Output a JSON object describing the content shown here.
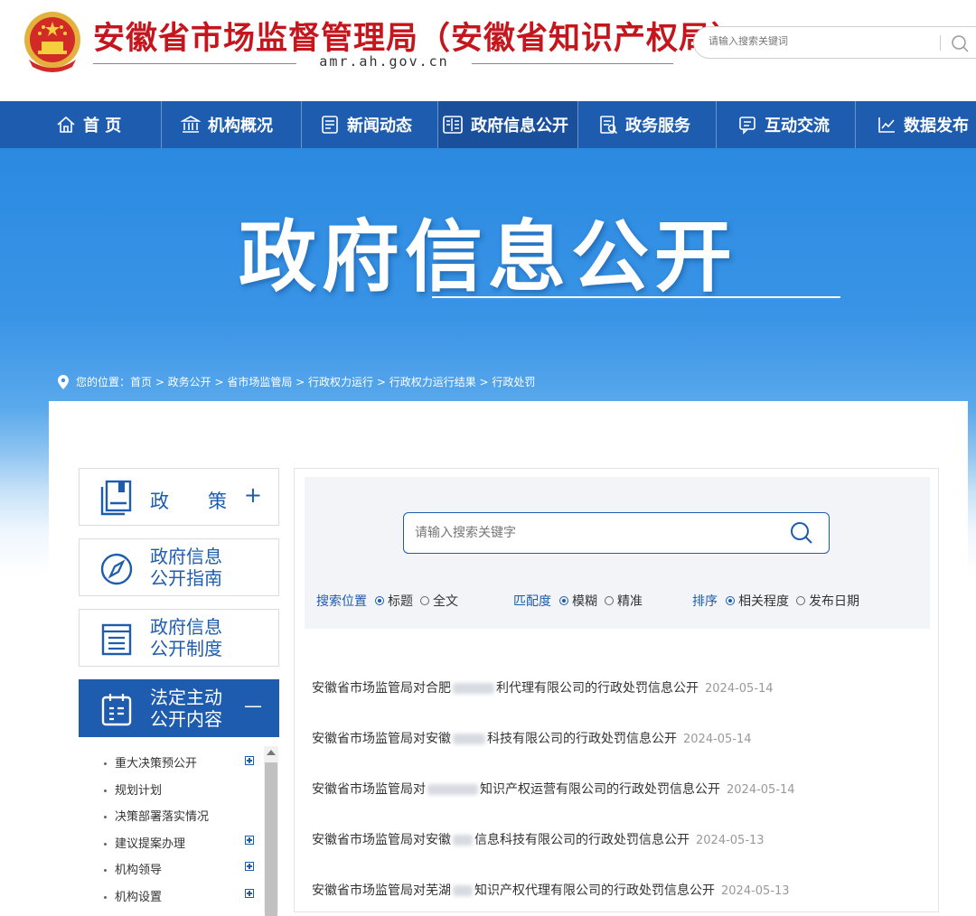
{
  "header": {
    "site_title": "安徽省市场监督管理局（安徽省知识产权局）",
    "domain": "amr.ah.gov.cn",
    "search_placeholder": "请输入搜索关键词",
    "emblem_icon": "national-emblem-icon"
  },
  "nav": {
    "items": [
      {
        "label": "首 页",
        "icon": "home-icon"
      },
      {
        "label": "机构概况",
        "icon": "institution-icon"
      },
      {
        "label": "新闻动态",
        "icon": "news-icon"
      },
      {
        "label": "政府信息公开",
        "icon": "info-disclosure-icon",
        "active": true
      },
      {
        "label": "政务服务",
        "icon": "service-icon"
      },
      {
        "label": "互动交流",
        "icon": "chat-icon"
      },
      {
        "label": "数据发布",
        "icon": "chart-icon"
      }
    ]
  },
  "banner": {
    "title": "政府信息公开"
  },
  "breadcrumb": {
    "text": "您的位置：首页 > 政务公开 > 省市场监管局 > 行政权力运行 > 行政权力运行结果 > 行政处罚"
  },
  "sidebar": {
    "boxes": [
      {
        "label_1": "政",
        "label_2": "策",
        "toggle": "+"
      },
      {
        "line1": "政府信息",
        "line2": "公开指南"
      },
      {
        "line1": "政府信息",
        "line2": "公开制度"
      },
      {
        "line1": "法定主动",
        "line2": "公开内容",
        "toggle": "—",
        "active": true
      }
    ],
    "sub_items": [
      {
        "label": "重大决策预公开",
        "expandable": true
      },
      {
        "label": "规划计划",
        "expandable": false
      },
      {
        "label": "决策部署落实情况",
        "expandable": false
      },
      {
        "label": "建议提案办理",
        "expandable": true
      },
      {
        "label": "机构领导",
        "expandable": true
      },
      {
        "label": "机构设置",
        "expandable": true
      }
    ]
  },
  "search": {
    "placeholder": "请输入搜索关键字",
    "position_label": "搜索位置",
    "position_options": [
      "标题",
      "全文"
    ],
    "match_label": "匹配度",
    "match_options": [
      "模糊",
      "精准"
    ],
    "sort_label": "排序",
    "sort_options": [
      "相关程度",
      "发布日期"
    ]
  },
  "results": [
    {
      "prefix": "安徽省市场监管局对合肥",
      "suffix": "利代理有限公司的行政处罚信息公开",
      "date": "2024-05-14"
    },
    {
      "prefix": "安徽省市场监管局对安徽",
      "suffix": "科技有限公司的行政处罚信息公开",
      "date": "2024-05-14"
    },
    {
      "prefix": "安徽省市场监管局对",
      "suffix": "知识产权运营有限公司的行政处罚信息公开",
      "date": "2024-05-14"
    },
    {
      "prefix": "安徽省市场监管局对安徽",
      "suffix": "信息科技有限公司的行政处罚信息公开",
      "date": "2024-05-13"
    },
    {
      "prefix": "安徽省市场监管局对芜湖",
      "suffix": "知识产权代理有限公司的行政处罚信息公开",
      "date": "2024-05-13"
    }
  ],
  "colors": {
    "brand_red": "#c4161c",
    "nav_blue": "#1d5cae"
  }
}
